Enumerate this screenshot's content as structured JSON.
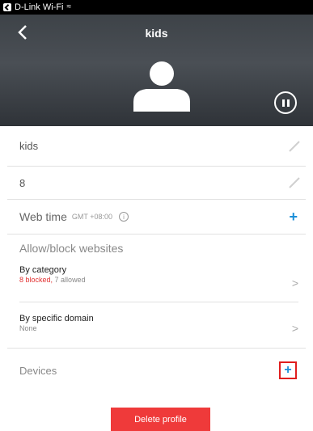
{
  "status_bar": {
    "carrier": "D-Link Wi-Fi"
  },
  "header": {
    "title": "kids"
  },
  "profile": {
    "name": "kids",
    "age": "8",
    "web_time_label": "Web time",
    "web_time_tz": "GMT +08:00",
    "info_symbol": "i"
  },
  "websites": {
    "section_title": "Allow/block websites",
    "by_category": {
      "label": "By category",
      "blocked": "8 blocked,",
      "allowed": "7 allowed"
    },
    "by_domain": {
      "label": "By specific domain",
      "detail": "None"
    }
  },
  "devices": {
    "label": "Devices"
  },
  "actions": {
    "delete_label": "Delete profile"
  },
  "colors": {
    "accent": "#1a8ed8",
    "danger": "#ef3a3a",
    "highlight": "#e01e1e"
  }
}
